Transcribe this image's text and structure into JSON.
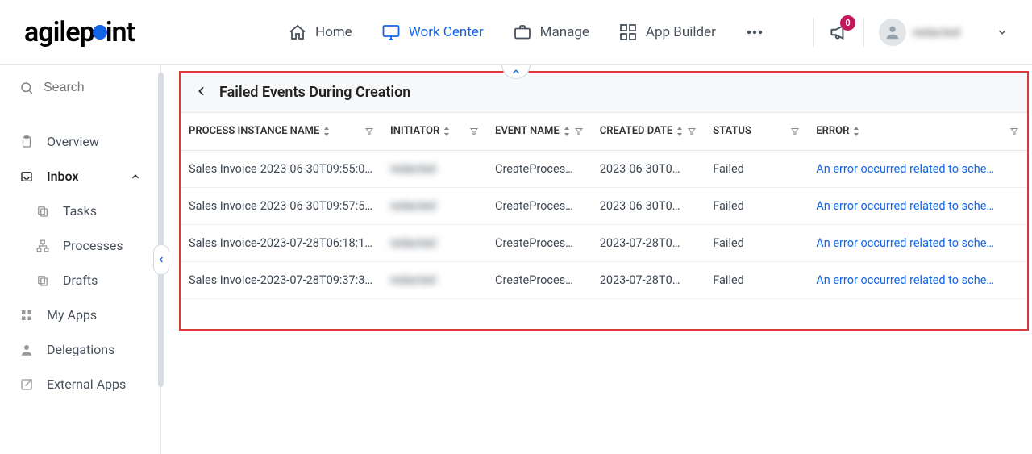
{
  "header": {
    "nav": {
      "home": "Home",
      "work_center": "Work Center",
      "manage": "Manage",
      "app_builder": "App Builder"
    },
    "notifications": {
      "count": "0"
    },
    "user": {
      "name": "redacted"
    }
  },
  "sidebar": {
    "search_placeholder": "Search",
    "items": {
      "overview": "Overview",
      "inbox": "Inbox",
      "tasks": "Tasks",
      "processes": "Processes",
      "drafts": "Drafts",
      "my_apps": "My Apps",
      "delegations": "Delegations",
      "ext_apps": "External Apps"
    }
  },
  "main": {
    "title": "Failed Events During Creation",
    "columns": {
      "process_instance_name": "PROCESS INSTANCE NAME",
      "initiator": "INITIATOR",
      "event_name": "EVENT NAME",
      "created_date": "CREATED DATE",
      "status": "STATUS",
      "error": "ERROR"
    },
    "rows": [
      {
        "process_instance_name": "Sales Invoice-2023-06-30T09:55:0…",
        "initiator": "redacted",
        "event_name": "CreateProces…",
        "created_date": "2023-06-30T0…",
        "status": "Failed",
        "error": "An error occurred related to sche…"
      },
      {
        "process_instance_name": "Sales Invoice-2023-06-30T09:57:5…",
        "initiator": "redacted",
        "event_name": "CreateProces…",
        "created_date": "2023-06-30T0…",
        "status": "Failed",
        "error": "An error occurred related to sche…"
      },
      {
        "process_instance_name": "Sales Invoice-2023-07-28T06:18:1…",
        "initiator": "redacted",
        "event_name": "CreateProces…",
        "created_date": "2023-07-28T0…",
        "status": "Failed",
        "error": "An error occurred related to sche…"
      },
      {
        "process_instance_name": "Sales Invoice-2023-07-28T09:37:3…",
        "initiator": "redacted",
        "event_name": "CreateProces…",
        "created_date": "2023-07-28T0…",
        "status": "Failed",
        "error": "An error occurred related to sche…"
      }
    ]
  }
}
